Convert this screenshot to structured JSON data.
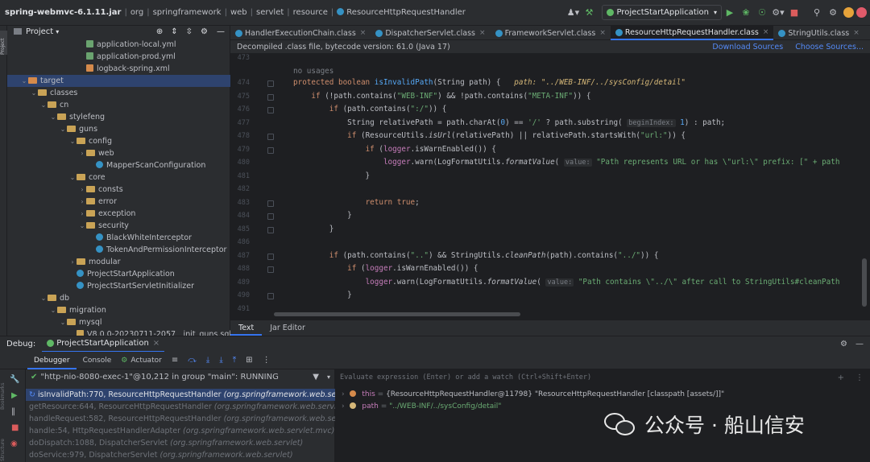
{
  "titlebar": {
    "breadcrumbs": [
      "spring-webmvc-6.1.11.jar",
      "org",
      "springframework",
      "web",
      "servlet",
      "resource",
      "ResourceHttpRequestHandler"
    ],
    "run_config": "ProjectStartApplication"
  },
  "project_panel": {
    "title": "Project",
    "tree": [
      {
        "label": "application-local.yml",
        "icon": "yml-icon",
        "depth": 7
      },
      {
        "label": "application-prod.yml",
        "icon": "yml-icon",
        "depth": 7
      },
      {
        "label": "logback-spring.xml",
        "icon": "xml-icon",
        "depth": 7
      },
      {
        "label": "target",
        "icon": "folder-icon",
        "depth": 1,
        "expanded": true,
        "selected": true
      },
      {
        "label": "classes",
        "icon": "folder-icon",
        "depth": 2,
        "expanded": true
      },
      {
        "label": "cn",
        "icon": "folder-icon",
        "depth": 3,
        "expanded": true
      },
      {
        "label": "stylefeng",
        "icon": "folder-icon",
        "depth": 4,
        "expanded": true
      },
      {
        "label": "guns",
        "icon": "folder-icon",
        "depth": 5,
        "expanded": true
      },
      {
        "label": "config",
        "icon": "folder-icon",
        "depth": 6,
        "expanded": true
      },
      {
        "label": "web",
        "icon": "folder-icon",
        "depth": 7,
        "expanded": false
      },
      {
        "label": "MapperScanConfiguration",
        "icon": "class-icon",
        "depth": 8
      },
      {
        "label": "core",
        "icon": "folder-icon",
        "depth": 6,
        "expanded": true
      },
      {
        "label": "consts",
        "icon": "folder-icon",
        "depth": 7,
        "expanded": false
      },
      {
        "label": "error",
        "icon": "folder-icon",
        "depth": 7,
        "expanded": false
      },
      {
        "label": "exception",
        "icon": "folder-icon",
        "depth": 7,
        "expanded": false
      },
      {
        "label": "security",
        "icon": "folder-icon",
        "depth": 7,
        "expanded": true
      },
      {
        "label": "BlackWhiteInterceptor",
        "icon": "class-icon",
        "depth": 8
      },
      {
        "label": "TokenAndPermissionInterceptor",
        "icon": "class-icon",
        "depth": 8
      },
      {
        "label": "modular",
        "icon": "folder-icon",
        "depth": 6,
        "expanded": false
      },
      {
        "label": "ProjectStartApplication",
        "icon": "class-icon",
        "depth": 6
      },
      {
        "label": "ProjectStartServletInitializer",
        "icon": "class-icon",
        "depth": 6
      },
      {
        "label": "db",
        "icon": "folder-icon",
        "depth": 3,
        "expanded": true
      },
      {
        "label": "migration",
        "icon": "folder-icon",
        "depth": 4,
        "expanded": true
      },
      {
        "label": "mysql",
        "icon": "folder-icon",
        "depth": 5,
        "expanded": true
      },
      {
        "label": "V8.0.0-20230711-2057__init_guns.sql",
        "icon": "sql-icon",
        "depth": 6
      }
    ]
  },
  "editor": {
    "tabs": [
      {
        "label": "HandlerExecutionChain.class",
        "active": false
      },
      {
        "label": "DispatcherServlet.class",
        "active": false
      },
      {
        "label": "FrameworkServlet.class",
        "active": false
      },
      {
        "label": "ResourceHttpRequestHandler.class",
        "active": true
      },
      {
        "label": "StringUtils.class",
        "active": false
      }
    ],
    "banner_text": "Decompiled .class file, bytecode version: 61.0 (Java 17)",
    "banner_links": [
      "Download Sources",
      "Choose Sources..."
    ],
    "usages_hint": "no usages",
    "line_numbers": [
      "473",
      "474",
      "475",
      "476",
      "477",
      "478",
      "479",
      "480",
      "481",
      "482",
      "483",
      "484",
      "485",
      "486",
      "487",
      "488",
      "489",
      "490",
      "491"
    ],
    "bottom_tabs": [
      "Text",
      "Jar Editor"
    ]
  },
  "debug": {
    "title": "Debug:",
    "session": "ProjectStartApplication",
    "tabs": [
      "Debugger",
      "Console",
      "Actuator"
    ],
    "thread": "\"http-nio-8080-exec-1\"@10,212 in group \"main\": RUNNING",
    "eval_placeholder": "Evaluate expression (Enter) or add a watch (Ctrl+Shift+Enter)",
    "frames": [
      {
        "method": "isInvalidPath:770, ResourceHttpRequestHandler",
        "pkg": "(org.springframework.web.servlet"
      },
      {
        "method": "getResource:644, ResourceHttpRequestHandler",
        "pkg": "(org.springframework.web.servlet"
      },
      {
        "method": "handleRequest:582, ResourceHttpRequestHandler",
        "pkg": "(org.springframework.web.servle"
      },
      {
        "method": "handle:54, HttpRequestHandlerAdapter",
        "pkg": "(org.springframework.web.servlet.mvc)"
      },
      {
        "method": "doDispatch:1088, DispatcherServlet",
        "pkg": "(org.springframework.web.servlet)"
      },
      {
        "method": "doService:979, DispatcherServlet",
        "pkg": "(org.springframework.web.servlet)"
      }
    ],
    "variables": [
      {
        "name": "this",
        "value": "{ResourceHttpRequestHandler@11798} \"ResourceHttpRequestHandler [classpath [assets/]]\""
      },
      {
        "name": "path",
        "value": "\"../WEB-INF/../sysConfig/detail\""
      }
    ]
  },
  "watermark": {
    "text": "公众号 · 船山信安"
  }
}
